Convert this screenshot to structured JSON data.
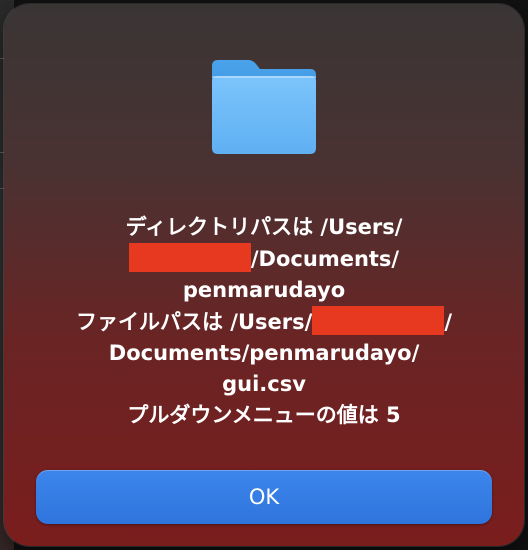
{
  "dialog": {
    "icon": "folder-icon",
    "message_lines": [
      "ディレクトリパスは /Users/",
      "/Documents/",
      "penmarudayo",
      "ファイルパスは /Users/",
      "/",
      "Documents/penmarudayo/",
      "gui.csv",
      "プルダウンメニューの値は 5"
    ],
    "ok_label": "OK"
  },
  "colors": {
    "redaction": "#e6391f",
    "accent_button": "#3079e0"
  }
}
